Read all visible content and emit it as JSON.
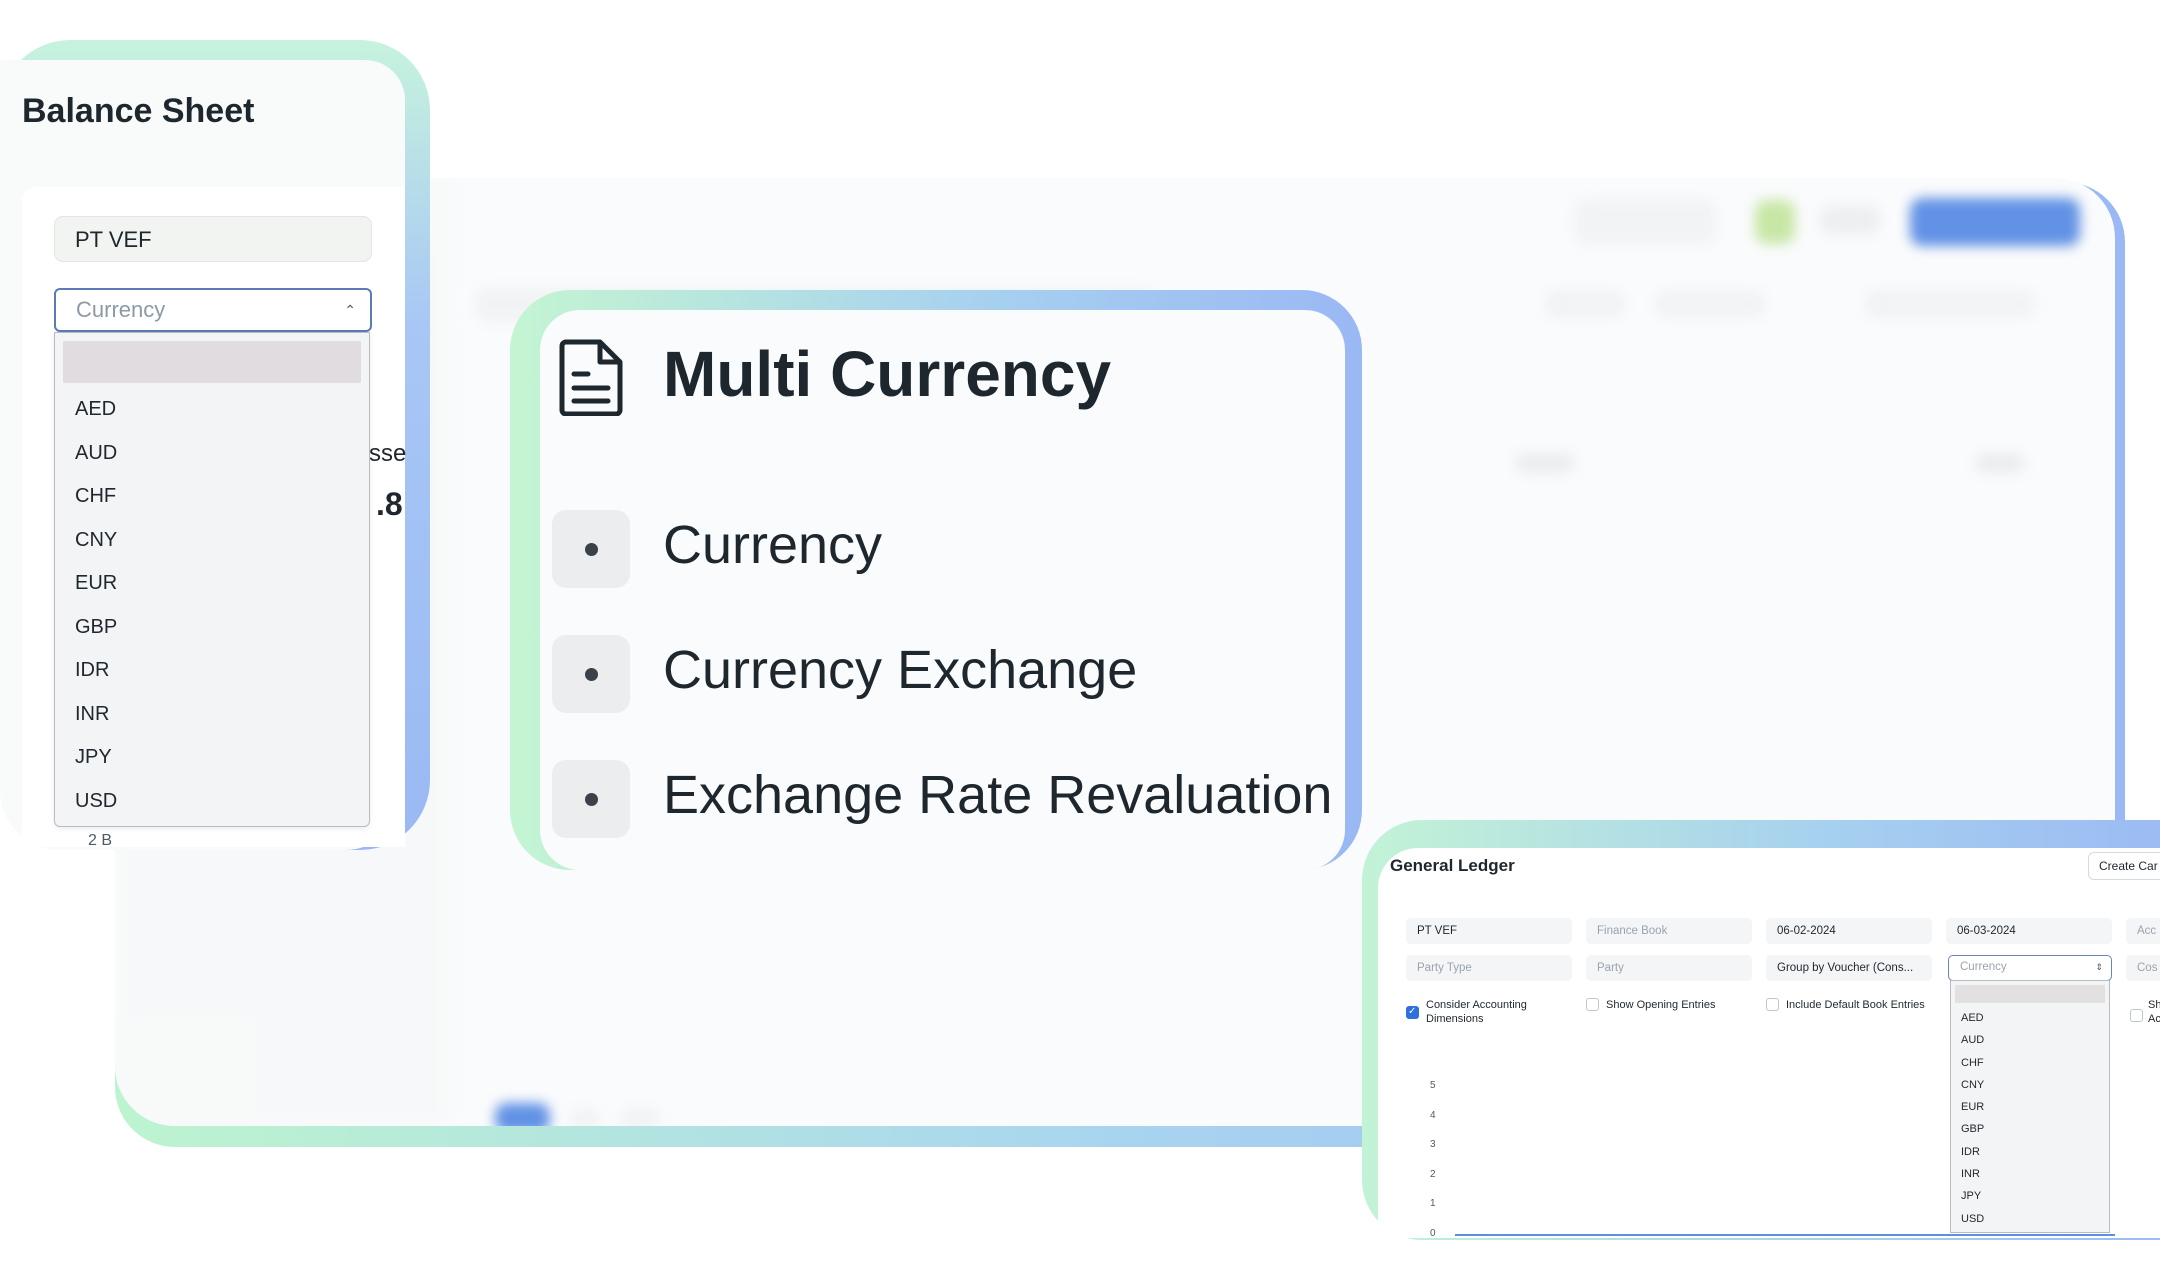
{
  "balance_sheet": {
    "title": "Balance Sheet",
    "company": "PT VEF",
    "currency_placeholder": "Currency",
    "currency_options": [
      "AED",
      "AUD",
      "CHF",
      "CNY",
      "EUR",
      "GBP",
      "IDR",
      "INR",
      "JPY",
      "USD"
    ],
    "partial_label": "sse",
    "partial_value": ".8",
    "footer_text": "2 B"
  },
  "multi_currency": {
    "title": "Multi Currency",
    "items": [
      "Currency",
      "Currency Exchange",
      "Exchange Rate Revaluation"
    ]
  },
  "general_ledger": {
    "title": "General Ledger",
    "create_button": "Create Car",
    "fields": {
      "company": "PT VEF",
      "finance_book": "Finance Book",
      "from_date": "06-02-2024",
      "to_date": "06-03-2024",
      "account_partial": "Acc",
      "party_type": "Party Type",
      "party": "Party",
      "group_by": "Group by Voucher (Cons...",
      "currency": "Currency",
      "cost_partial": "Cos"
    },
    "checkboxes": {
      "consider_accounting_dimensions": "Consider Accounting Dimensions",
      "show_opening_entries": "Show Opening Entries",
      "include_default_book_entries": "Include Default Book Entries",
      "partial_1": "Sh",
      "partial_2": "Ac"
    },
    "currency_options": [
      "AED",
      "AUD",
      "CHF",
      "CNY",
      "EUR",
      "GBP",
      "IDR",
      "INR",
      "JPY",
      "USD"
    ],
    "y_ticks": [
      "5",
      "4",
      "3",
      "2",
      "1",
      "0"
    ]
  },
  "colors": {
    "accent_blue": "#2f6fde",
    "frame_green": "#c4f5d2",
    "frame_blue": "#9ab8f4"
  }
}
